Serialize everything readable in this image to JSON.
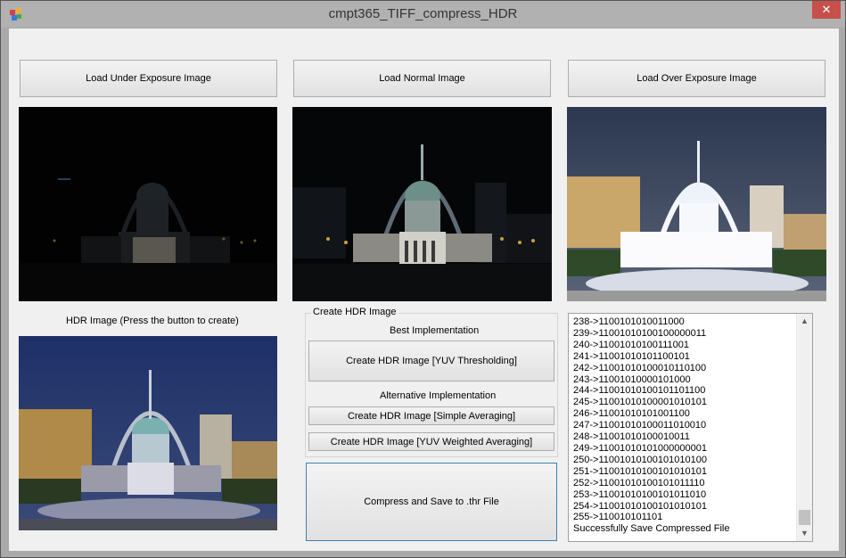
{
  "window": {
    "title": "cmpt365_TIFF_compress_HDR"
  },
  "buttons": {
    "load_under": "Load Under Exposure Image",
    "load_normal": "Load Normal Image",
    "load_over": "Load Over Exposure Image",
    "yuv_threshold": "Create HDR Image [YUV Thresholding]",
    "simple_avg": "Create HDR Image [Simple Averaging]",
    "yuv_weighted": "Create HDR Image [YUV Weighted Averaging]",
    "compress_save": "Compress and Save to .thr File"
  },
  "labels": {
    "hdr_image": "HDR Image (Press the button to create)",
    "group_title": "Create HDR Image",
    "best": "Best Implementation",
    "alternative": "Alternative Implementation"
  },
  "log": {
    "lines": [
      "238->1100101010011000",
      "239->11001010100100000011",
      "240->11001010100111001",
      "241->11001010101100101",
      "242->11001010100010110100",
      "243->11001010000101000",
      "244->11001010100101101100",
      "245->11001010100001010101",
      "246->11001010101001100",
      "247->11001010100011010010",
      "248->11001010100010011",
      "249->11001010101000000001",
      "250->11001010100101010100",
      "251->11001010100101010101",
      "252->11001010100101011110",
      "253->11001010100101011010",
      "254->11001010100101010101",
      "255->110010101101",
      "Successfully Save Compressed File"
    ]
  }
}
